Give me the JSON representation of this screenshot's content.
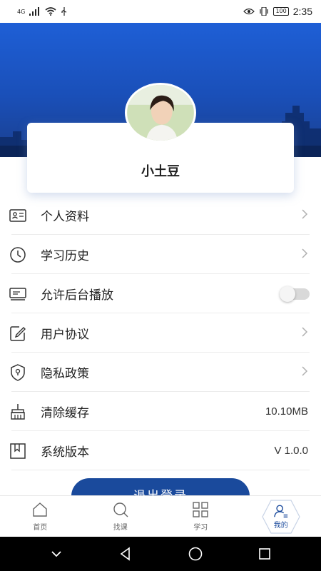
{
  "status_bar": {
    "network": "4G",
    "battery": "100",
    "time": "2:35"
  },
  "profile": {
    "username": "小土豆"
  },
  "menu": [
    {
      "label": "个人资料",
      "icon": "id-card-icon",
      "trailing": "chevron"
    },
    {
      "label": "学习历史",
      "icon": "clock-icon",
      "trailing": "chevron"
    },
    {
      "label": "允许后台播放",
      "icon": "screen-icon",
      "trailing": "toggle",
      "toggle_on": false
    },
    {
      "label": "用户协议",
      "icon": "edit-icon",
      "trailing": "chevron"
    },
    {
      "label": "隐私政策",
      "icon": "shield-icon",
      "trailing": "chevron"
    },
    {
      "label": "清除缓存",
      "icon": "broom-icon",
      "trailing": "value",
      "value": "10.10MB"
    },
    {
      "label": "系统版本",
      "icon": "bookmark-icon",
      "trailing": "value",
      "value": "V 1.0.0"
    }
  ],
  "logout_label": "退出登录",
  "tabs": [
    {
      "label": "首页",
      "icon": "home-icon",
      "active": false
    },
    {
      "label": "找课",
      "icon": "search-icon",
      "active": false
    },
    {
      "label": "学习",
      "icon": "grid-icon",
      "active": false
    },
    {
      "label": "我的",
      "icon": "user-icon",
      "active": true
    }
  ],
  "colors": {
    "primary": "#1a4a9c",
    "hero_blue": "#1e5fd6"
  }
}
